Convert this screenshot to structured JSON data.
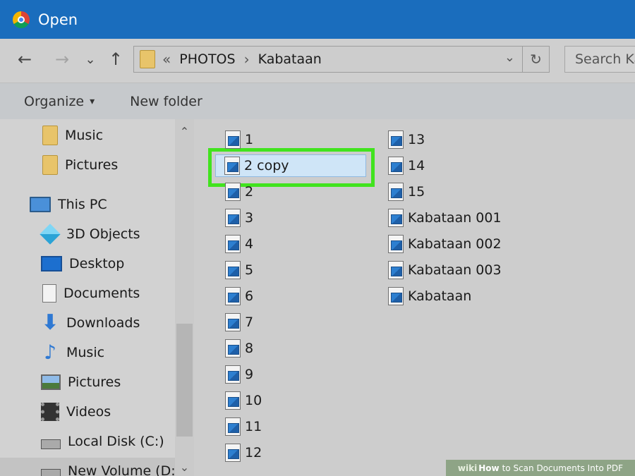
{
  "window": {
    "title": "Open"
  },
  "nav": {
    "back": "←",
    "forward": "→",
    "recent": "⌄",
    "up": "↑"
  },
  "address": {
    "separator": "«",
    "crumbs": [
      "PHOTOS",
      "Kabataan"
    ],
    "chevron": "›",
    "dropdown": "⌄",
    "refresh": "↻"
  },
  "search": {
    "placeholder": "Search Ka"
  },
  "toolbar": {
    "organize": "Organize",
    "organize_caret": "▾",
    "new_folder": "New folder"
  },
  "sidebar": {
    "items": [
      {
        "label": "Music",
        "icon": "folder-icon"
      },
      {
        "label": "Pictures",
        "icon": "folder-icon"
      },
      {
        "label": "This PC",
        "icon": "computer-icon"
      },
      {
        "label": "3D Objects",
        "icon": "cube-icon"
      },
      {
        "label": "Desktop",
        "icon": "desktop-icon"
      },
      {
        "label": "Documents",
        "icon": "document-icon"
      },
      {
        "label": "Downloads",
        "icon": "download-arrow-icon"
      },
      {
        "label": "Music",
        "icon": "music-note-icon"
      },
      {
        "label": "Pictures",
        "icon": "pictures-icon"
      },
      {
        "label": "Videos",
        "icon": "film-icon"
      },
      {
        "label": "Local Disk (C:)",
        "icon": "disk-icon"
      },
      {
        "label": "New Volume (D:",
        "icon": "disk-icon"
      }
    ],
    "scroll_up": "⌃",
    "scroll_down": "⌄"
  },
  "files": {
    "column1": [
      "1",
      "2 copy",
      "2",
      "3",
      "4",
      "5",
      "6",
      "7",
      "8",
      "9",
      "10",
      "11",
      "12"
    ],
    "column2": [
      "13",
      "14",
      "15",
      "Kabataan 001",
      "Kabataan 002",
      "Kabataan 003",
      "Kabataan"
    ],
    "selected": "2 copy"
  },
  "watermark": {
    "wiki": "wiki",
    "how": "How",
    "text": "to Scan Documents Into PDF"
  },
  "colors": {
    "titlebar": "#1a6dbd",
    "highlight": "#41e31e",
    "selection": "#cfe5f7"
  }
}
